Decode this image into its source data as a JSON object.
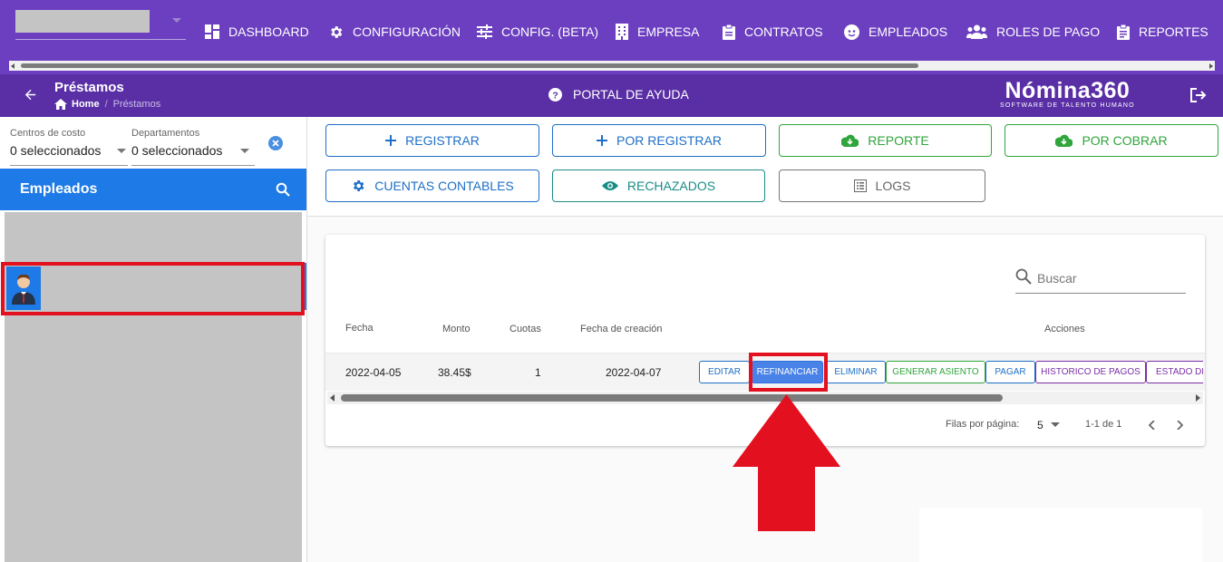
{
  "topnav": {
    "items": [
      {
        "label": "DASHBOARD",
        "icon": "dashboard-icon"
      },
      {
        "label": "CONFIGURACIÓN",
        "icon": "gear-icon"
      },
      {
        "label": "CONFIG. (BETA)",
        "icon": "sliders-icon"
      },
      {
        "label": "EMPRESA",
        "icon": "building-icon"
      },
      {
        "label": "CONTRATOS",
        "icon": "clipboard-icon"
      },
      {
        "label": "EMPLEADOS",
        "icon": "face-icon"
      },
      {
        "label": "ROLES DE PAGO",
        "icon": "group-icon"
      },
      {
        "label": "REPORTES",
        "icon": "report-icon"
      }
    ]
  },
  "header": {
    "title": "Préstamos",
    "breadcrumb_home": "Home",
    "breadcrumb_sep": "/",
    "breadcrumb_current": "Préstamos",
    "help_label": "PORTAL DE AYUDA",
    "logo_text": "Nómina360",
    "logo_tagline": "SOFTWARE DE TALENTO HUMANO"
  },
  "filters": {
    "cost_centers_label": "Centros de costo",
    "cost_centers_value": "0 seleccionados",
    "departments_label": "Departamentos",
    "departments_value": "0 seleccionados"
  },
  "employees": {
    "title": "Empleados"
  },
  "actions": {
    "registrar": "REGISTRAR",
    "por_registrar": "POR REGISTRAR",
    "reporte": "REPORTE",
    "por_cobrar": "POR COBRAR",
    "cuentas_contables": "CUENTAS CONTABLES",
    "rechazados": "RECHAZADOS",
    "logs": "LOGS"
  },
  "table": {
    "search_placeholder": "Buscar",
    "headers": {
      "fecha": "Fecha",
      "monto": "Monto",
      "cuotas": "Cuotas",
      "fecha_creacion": "Fecha de creación",
      "acciones": "Acciones"
    },
    "rows": [
      {
        "fecha": "2022-04-05",
        "monto": "38.45$",
        "cuotas": "1",
        "fecha_creacion": "2022-04-07"
      }
    ],
    "row_actions": {
      "editar": "EDITAR",
      "refinanciar": "REFINANCIAR",
      "eliminar": "ELIMINAR",
      "generar_asiento": "GENERAR ASIENTO",
      "pagar": "PAGAR",
      "historico": "HISTORICO DE PAGOS",
      "estado": "ESTADO DE"
    },
    "pagination": {
      "rows_label": "Filas por página:",
      "rows_value": "5",
      "range": "1-1 de 1"
    }
  },
  "colors": {
    "topbar": "#6c3fc0",
    "subheader": "#5a2fa6",
    "accent_blue": "#1e7ae6",
    "highlight_red": "#e3101f"
  }
}
